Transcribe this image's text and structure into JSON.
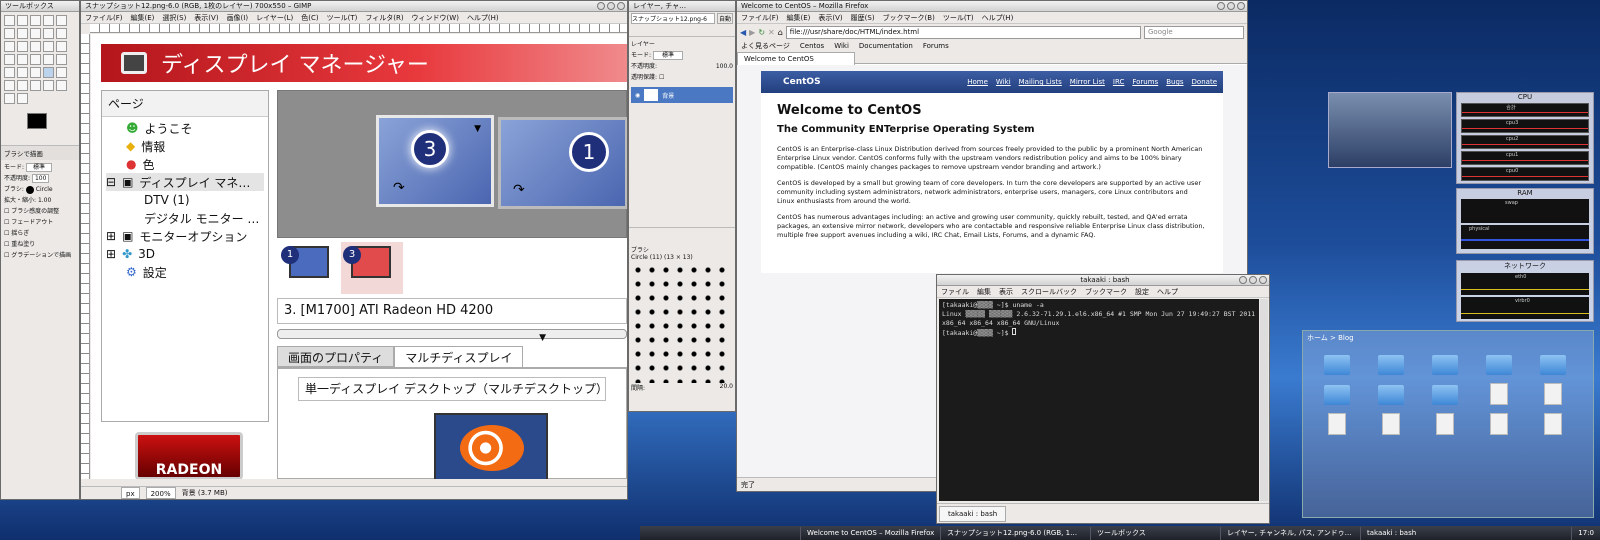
{
  "toolbox": {
    "title": "ツールボックス",
    "brush_section": "ブラシで描画",
    "mode_label": "モード:",
    "mode_value": "標準",
    "opacity_label": "不透明度:",
    "opacity_value": "100",
    "brush_label": "ブラシ:",
    "brush_value": "Circle",
    "scale_label": "拡大・縮小:",
    "scale_value": "1.00",
    "options": [
      "ブラシ感度の調整",
      "フェードアウト",
      "揺らぎ",
      "重ね塗り",
      "グラデーションで描画"
    ]
  },
  "gimp": {
    "title": "スナップショット12.png-6.0 (RGB, 1枚のレイヤー) 700x550 – GIMP",
    "menu": [
      "ファイル(F)",
      "編集(E)",
      "選択(S)",
      "表示(V)",
      "画像(I)",
      "レイヤー(L)",
      "色(C)",
      "ツール(T)",
      "フィルタ(R)",
      "ウィンドウ(W)",
      "ヘルプ(H)"
    ],
    "unit": "px",
    "zoom": "200%",
    "status": "背景 (3.7 MB)"
  },
  "display_manager": {
    "header_title": "ディスプレイ マネージャー",
    "pages_header": "ページ",
    "tree": [
      "ようこそ",
      "情報",
      "色",
      "ディスプレイ マネ…",
      "DTV (1)",
      "デジタル モニター …",
      "モニターオプション",
      "3D",
      "設定"
    ],
    "monitor_3": "3",
    "monitor_1": "1",
    "small_1": "1",
    "small_3": "3",
    "device_label": "3.  [M1700] ATI Radeon HD 4200",
    "tab_properties": "画面のプロパティ",
    "tab_multi": "マルチディスプレイ",
    "mode_select": "単一ディスプレイ デスクトップ（マルチデスクトップ）",
    "radeon": "RADEON"
  },
  "layers": {
    "title": "レイヤー, チャ…",
    "image_select": "スナップショット12.png-6",
    "auto": "自動",
    "section": "レイヤー",
    "mode_label": "モード:",
    "mode_value": "標準",
    "opacity_label": "不透明度:",
    "opacity_value": "100.0",
    "lock_label": "透明保護:",
    "layer_name": "背景",
    "brushes_label": "ブラシ",
    "brush_name": "Circle (11) (13 × 13)",
    "spacing_label": "間隔:",
    "spacing_value": "20.0"
  },
  "firefox": {
    "title": "Welcome to CentOS – Mozilla Firefox",
    "menu": [
      "ファイル(F)",
      "編集(E)",
      "表示(V)",
      "履歴(S)",
      "ブックマーク(B)",
      "ツール(T)",
      "ヘルプ(H)"
    ],
    "url": "file:///usr/share/doc/HTML/index.html",
    "search_placeholder": "Google",
    "bookmarks": [
      "よく見るページ",
      "Centos",
      "Wiki",
      "Documentation",
      "Forums"
    ],
    "tab": "Welcome to CentOS",
    "status": "完了",
    "page": {
      "logo": "CentOS",
      "nav": [
        "Home",
        "Wiki",
        "Mailing Lists",
        "Mirror List",
        "IRC",
        "Forums",
        "Bugs",
        "Donate"
      ],
      "h1": "Welcome to CentOS",
      "h2": "The Community ENTerprise Operating System",
      "p1": "CentOS is an Enterprise-class Linux Distribution derived from sources freely provided to the public by a prominent North American Enterprise Linux vendor. CentOS conforms fully with the upstream vendors redistribution policy and aims to be 100% binary compatible. (CentOS mainly changes packages to remove upstream vendor branding and artwork.)",
      "p2": "CentOS is developed by a small but growing team of core developers.  In turn the core developers are supported by an active user community including system administrators, network administrators, enterprise users, managers, core Linux contributors and Linux enthusiasts from around the world.",
      "p3": "CentOS has numerous advantages including: an active and growing user community, quickly rebuilt, tested, and QA'ed errata packages, an extensive mirror network, developers who are contactable and responsive reliable Enterprise Linux class distribution, multiple free support avenues including a wiki, IRC Chat, Email Lists, Forums, and a dynamic FAQ."
    }
  },
  "terminal": {
    "title": "takaaki : bash",
    "menu": [
      "ファイル",
      "編集",
      "表示",
      "スクロールバック",
      "ブックマーク",
      "設定",
      "ヘルプ"
    ],
    "line1": "[takaaki@▒▒▒▒ ~]$ uname -a",
    "line2": "Linux ▒▒▒▒▒ ▒▒▒▒▒▒ 2.6.32-71.29.1.el6.x86_64 #1 SMP Mon Jun 27 19:49:27 BST 2011 x86_64 x86_64 x86_64 GNU/Linux",
    "line3": "[takaaki@▒▒▒▒ ~]$ ",
    "tab": "takaaki : bash"
  },
  "monitors": {
    "cpu_title": "CPU",
    "cpu_rows": [
      "合計",
      "cpu3",
      "cpu2",
      "cpu1",
      "cpu0"
    ],
    "ram_title": "RAM",
    "ram_rows": [
      "swap",
      "physical"
    ],
    "net_title": "ネットワーク",
    "net_rows": [
      "eth0",
      "virbr0"
    ]
  },
  "filemanager": {
    "title": "ホーム > Blog"
  },
  "taskbar": {
    "items": [
      "Welcome to CentOS – Mozilla Firefox",
      "スナップショット12.png-6.0 (RGB, 1…",
      "ツールボックス",
      "レイヤー, チャンネル, パス, アンドゥ…",
      "takaaki : bash"
    ],
    "clock": "17:0"
  }
}
